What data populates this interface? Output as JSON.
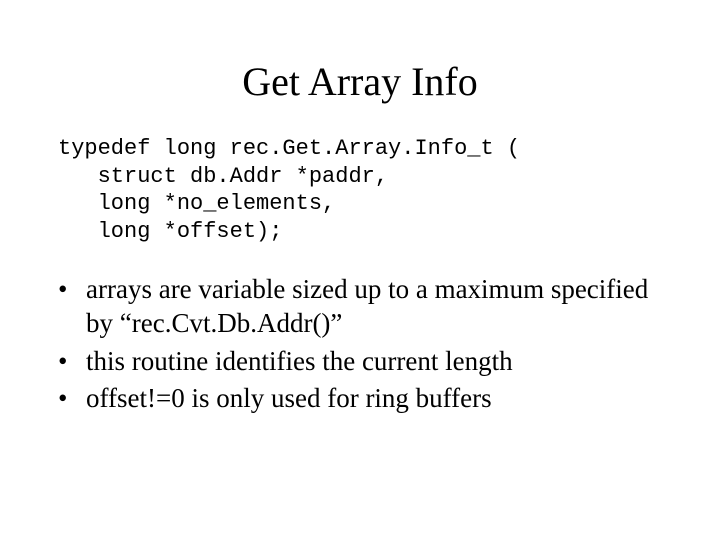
{
  "title": "Get Array Info",
  "code": {
    "line1": "typedef long rec.Get.Array.Info_t (",
    "line2": "   struct db.Addr *paddr,",
    "line3": "   long *no_elements,",
    "line4": "   long *offset);"
  },
  "bullets": [
    "arrays are variable sized up to a maximum specified by “rec.Cvt.Db.Addr()”",
    "this routine identifies the current length",
    "offset!=0 is only used for ring buffers"
  ]
}
